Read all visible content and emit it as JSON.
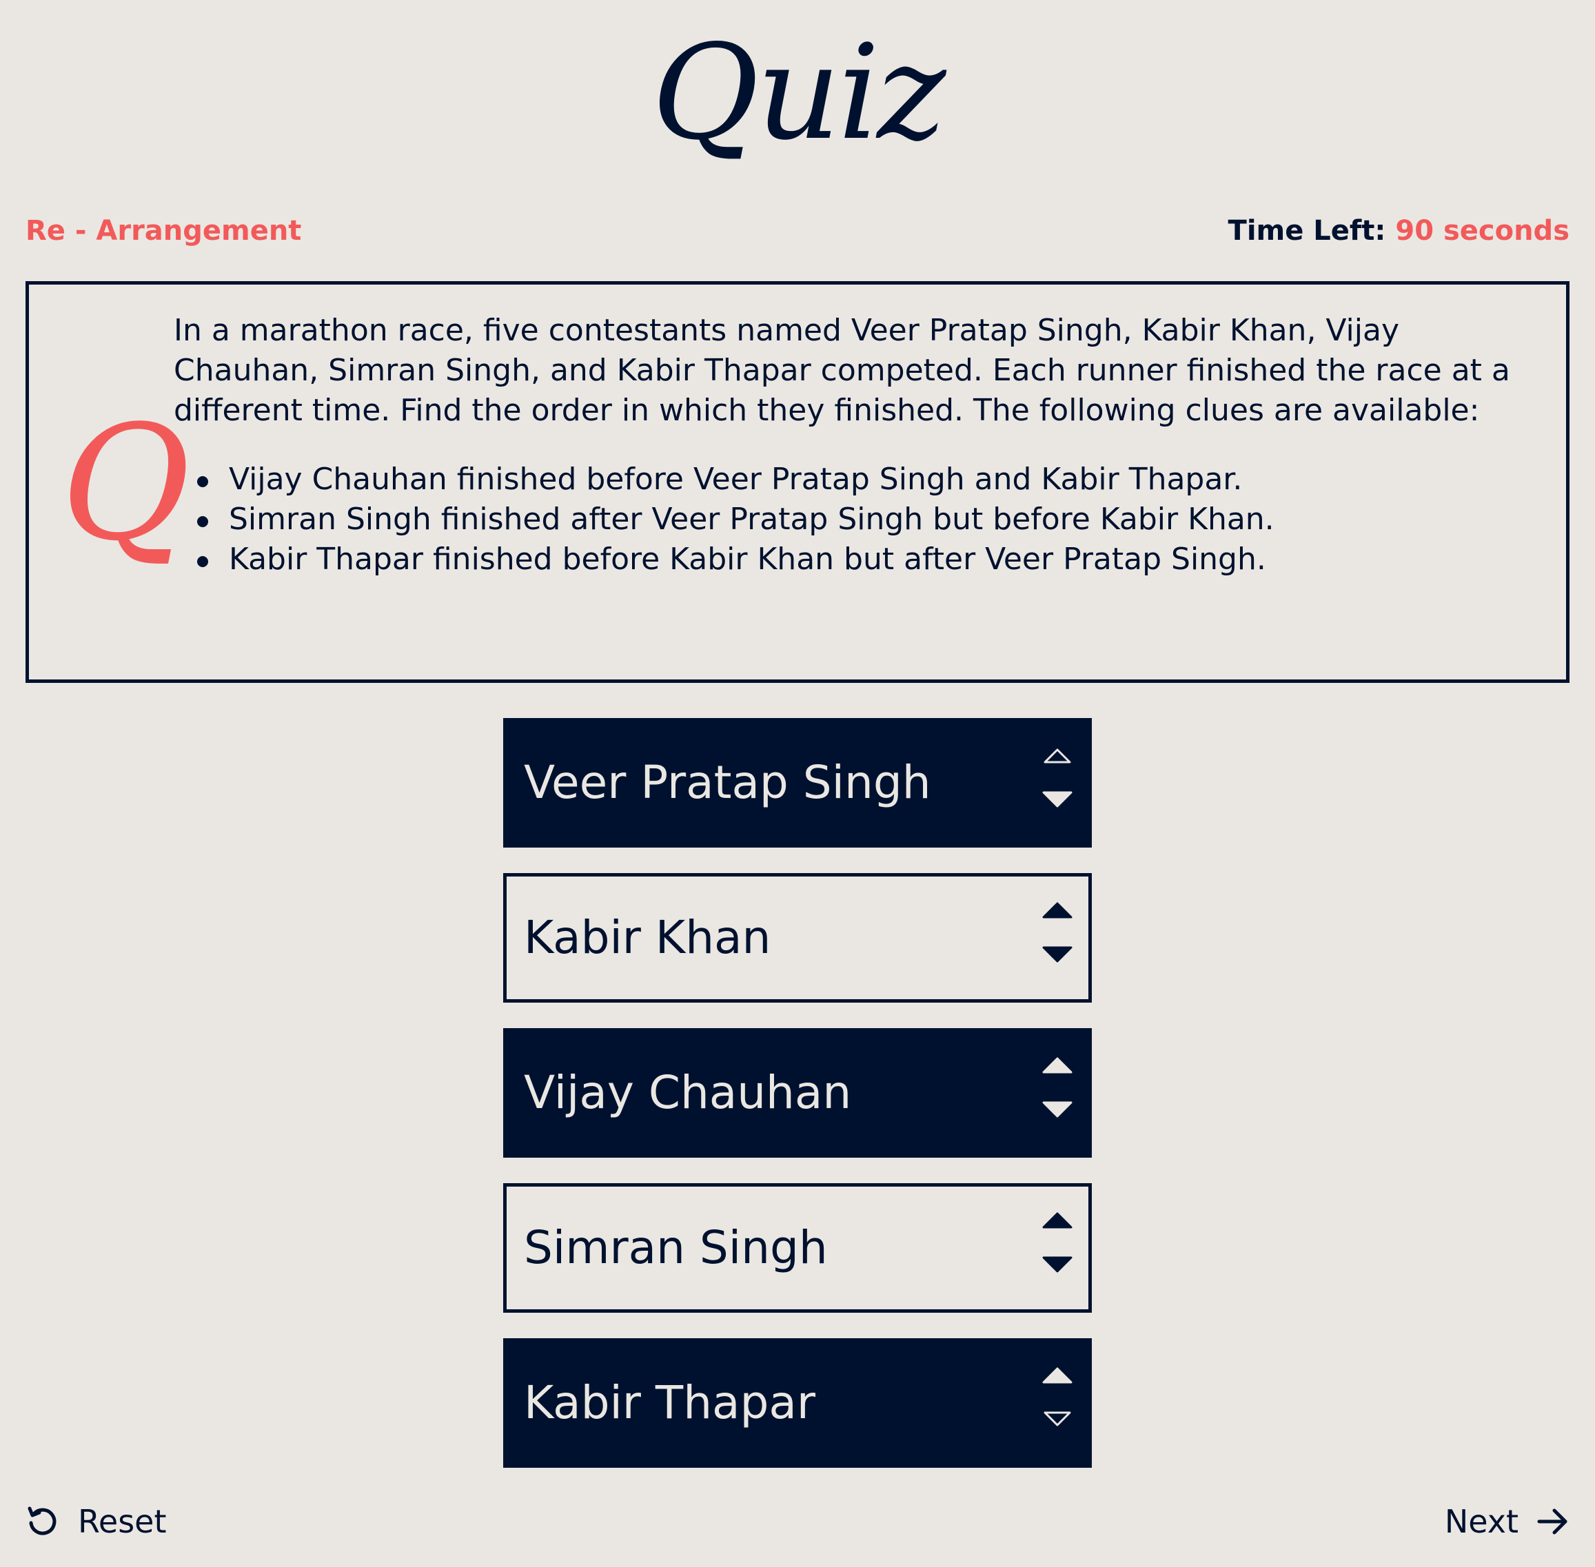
{
  "app": {
    "title": "Quiz"
  },
  "header": {
    "category": "Re - Arrangement",
    "timer_label": "Time Left:",
    "timer_value": "90 seconds"
  },
  "question": {
    "marker": "Q",
    "text": "In a marathon race, five contestants named Veer Pratap Singh, Kabir Khan, Vijay Chauhan, Simran Singh, and Kabir Thapar competed. Each runner finished the race at a different time. Find the order in which they finished. The following clues are available:",
    "clues": [
      "Vijay Chauhan finished before Veer Pratap Singh and Kabir Thapar.",
      "Simran Singh finished after Veer Pratap Singh but before Kabir Khan.",
      "Kabir Thapar finished before Kabir Khan but after Veer Pratap Singh."
    ]
  },
  "options": [
    {
      "label": "Veer Pratap Singh",
      "style": "dark",
      "up_enabled": false,
      "down_enabled": true
    },
    {
      "label": "Kabir Khan",
      "style": "light",
      "up_enabled": true,
      "down_enabled": true
    },
    {
      "label": "Vijay Chauhan",
      "style": "dark",
      "up_enabled": true,
      "down_enabled": true
    },
    {
      "label": "Simran Singh",
      "style": "light",
      "up_enabled": true,
      "down_enabled": true
    },
    {
      "label": "Kabir Thapar",
      "style": "dark",
      "up_enabled": true,
      "down_enabled": false
    }
  ],
  "footer": {
    "reset_label": "Reset",
    "next_label": "Next"
  },
  "colors": {
    "background": "#EAE7E2",
    "navy": "#00112F",
    "accent": "#F25A5A"
  },
  "icons": {
    "reset": "reset-icon",
    "next": "arrow-right-icon",
    "move_up": "chevron-up-icon",
    "move_down": "chevron-down-icon"
  }
}
